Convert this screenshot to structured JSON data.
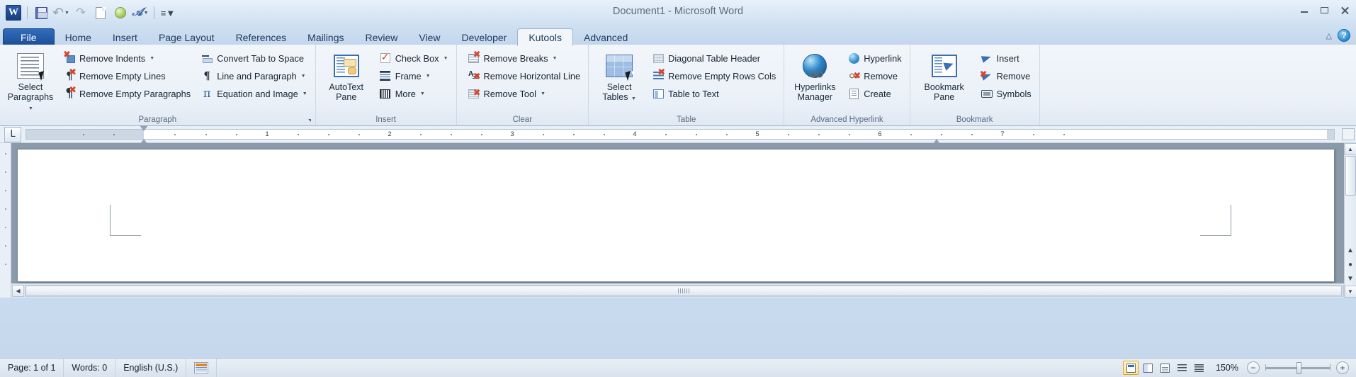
{
  "window": {
    "title": "Document1  -  Microsoft Word",
    "minimize": "Minimize",
    "restore": "Restore Down",
    "close": "Close"
  },
  "quick_access": {
    "app_letter": "W",
    "buttons": [
      {
        "name": "save",
        "label": "Save"
      },
      {
        "name": "undo",
        "label": "Undo"
      },
      {
        "name": "redo",
        "label": "Repeat"
      },
      {
        "name": "new",
        "label": "New"
      },
      {
        "name": "green-orb",
        "label": "Kutools"
      },
      {
        "name": "a-format",
        "label": "Format"
      },
      {
        "name": "customize",
        "label": "Customize Quick Access Toolbar"
      }
    ]
  },
  "tabs": [
    {
      "id": "file",
      "label": "File"
    },
    {
      "id": "home",
      "label": "Home"
    },
    {
      "id": "insert",
      "label": "Insert"
    },
    {
      "id": "page-layout",
      "label": "Page Layout"
    },
    {
      "id": "references",
      "label": "References"
    },
    {
      "id": "mailings",
      "label": "Mailings"
    },
    {
      "id": "review",
      "label": "Review"
    },
    {
      "id": "view",
      "label": "View"
    },
    {
      "id": "developer",
      "label": "Developer"
    },
    {
      "id": "kutools",
      "label": "Kutools"
    },
    {
      "id": "advanced",
      "label": "Advanced"
    }
  ],
  "active_tab": "Kutools",
  "help": {
    "glyph": "?",
    "label": "Microsoft Word Help"
  },
  "minimize_ribbon": {
    "glyph": "△",
    "label": "Minimize the Ribbon"
  },
  "ribbon": {
    "groups": [
      {
        "id": "paragraph",
        "label": "Paragraph",
        "has_dialog_launcher": true,
        "big_buttons": [
          {
            "name": "select-paragraphs",
            "label_line1": "Select",
            "label_line2": "Paragraphs",
            "has_caret": true,
            "icon": "select-paragraphs-icon"
          }
        ],
        "columns": [
          [
            {
              "name": "remove-indents",
              "label": "Remove Indents",
              "has_caret": true,
              "icon": "remove-indents-icon"
            },
            {
              "name": "remove-empty-lines",
              "label": "Remove Empty Lines",
              "has_caret": false,
              "icon": "remove-empty-lines-icon"
            },
            {
              "name": "remove-empty-paragraphs",
              "label": "Remove Empty Paragraphs",
              "has_caret": false,
              "icon": "remove-empty-paragraphs-icon"
            }
          ],
          [
            {
              "name": "convert-tab-to-space",
              "label": "Convert Tab to Space",
              "has_caret": false,
              "icon": "convert-tab-to-space-icon"
            },
            {
              "name": "line-and-paragraph",
              "label": "Line and Paragraph",
              "has_caret": true,
              "icon": "line-and-paragraph-icon"
            },
            {
              "name": "equation-and-image",
              "label": "Equation and Image",
              "has_caret": true,
              "icon": "equation-and-image-icon"
            }
          ]
        ]
      },
      {
        "id": "insert",
        "label": "Insert",
        "has_dialog_launcher": false,
        "big_buttons": [
          {
            "name": "autotext-pane",
            "label_line1": "AutoText",
            "label_line2": "Pane",
            "has_caret": false,
            "icon": "autotext-pane-icon"
          }
        ],
        "columns": [
          [
            {
              "name": "check-box",
              "label": "Check Box",
              "has_caret": true,
              "icon": "check-box-icon"
            },
            {
              "name": "frame",
              "label": "Frame",
              "has_caret": true,
              "icon": "frame-icon"
            },
            {
              "name": "more",
              "label": "More",
              "has_caret": true,
              "icon": "more-icon"
            }
          ]
        ]
      },
      {
        "id": "clear",
        "label": "Clear",
        "has_dialog_launcher": false,
        "big_buttons": [],
        "columns": [
          [
            {
              "name": "remove-breaks",
              "label": "Remove Breaks",
              "has_caret": true,
              "icon": "remove-breaks-icon"
            },
            {
              "name": "remove-horizontal-line",
              "label": "Remove Horizontal Line",
              "has_caret": false,
              "icon": "remove-horizontal-line-icon"
            },
            {
              "name": "remove-tool",
              "label": "Remove Tool",
              "has_caret": true,
              "icon": "remove-tool-icon"
            }
          ]
        ]
      },
      {
        "id": "table",
        "label": "Table",
        "has_dialog_launcher": false,
        "big_buttons": [
          {
            "name": "select-tables",
            "label_line1": "Select",
            "label_line2": "Tables",
            "has_caret": true,
            "icon": "select-tables-icon"
          }
        ],
        "columns": [
          [
            {
              "name": "diagonal-table-header",
              "label": "Diagonal Table Header",
              "has_caret": false,
              "icon": "diagonal-table-header-icon"
            },
            {
              "name": "remove-empty-rows-cols",
              "label": "Remove Empty Rows Cols",
              "has_caret": false,
              "icon": "remove-empty-rows-cols-icon"
            },
            {
              "name": "table-to-text",
              "label": "Table to Text",
              "has_caret": false,
              "icon": "table-to-text-icon"
            }
          ]
        ]
      },
      {
        "id": "advanced-hyperlink",
        "label": "Advanced Hyperlink",
        "has_dialog_launcher": false,
        "big_buttons": [
          {
            "name": "hyperlinks-manager",
            "label_line1": "Hyperlinks",
            "label_line2": "Manager",
            "has_caret": false,
            "icon": "hyperlinks-manager-icon"
          }
        ],
        "columns": [
          [
            {
              "name": "hyperlink",
              "label": "Hyperlink",
              "has_caret": false,
              "icon": "hyperlink-icon"
            },
            {
              "name": "remove-hyperlink",
              "label": "Remove",
              "has_caret": false,
              "icon": "remove-hyperlink-icon"
            },
            {
              "name": "create-hyperlink",
              "label": "Create",
              "has_caret": false,
              "icon": "create-hyperlink-icon"
            }
          ]
        ]
      },
      {
        "id": "bookmark",
        "label": "Bookmark",
        "has_dialog_launcher": false,
        "big_buttons": [
          {
            "name": "bookmark-pane",
            "label_line1": "Bookmark",
            "label_line2": "Pane",
            "has_caret": false,
            "icon": "bookmark-pane-icon"
          }
        ],
        "columns": [
          [
            {
              "name": "insert-bookmark",
              "label": "Insert",
              "has_caret": false,
              "icon": "insert-bookmark-icon"
            },
            {
              "name": "remove-bookmark",
              "label": "Remove",
              "has_caret": false,
              "icon": "remove-bookmark-icon"
            },
            {
              "name": "symbols",
              "label": "Symbols",
              "has_caret": false,
              "icon": "symbols-icon"
            }
          ]
        ]
      }
    ]
  },
  "ruler": {
    "tab_selector_glyph": "L",
    "numbers": [
      "1",
      "2",
      "3",
      "4",
      "5",
      "6",
      "7"
    ]
  },
  "status_bar": {
    "page": "Page: 1 of 1",
    "words": "Words: 0",
    "language": "English (U.S.)",
    "proofing_label": "Proofing errors",
    "views": [
      {
        "name": "print-layout",
        "label": "Print Layout",
        "selected": true
      },
      {
        "name": "full-screen-reading",
        "label": "Full Screen Reading",
        "selected": false
      },
      {
        "name": "web-layout",
        "label": "Web Layout",
        "selected": false
      },
      {
        "name": "outline",
        "label": "Outline",
        "selected": false
      },
      {
        "name": "draft",
        "label": "Draft",
        "selected": false
      }
    ],
    "zoom": "150%",
    "zoom_out": "−",
    "zoom_in": "+"
  }
}
